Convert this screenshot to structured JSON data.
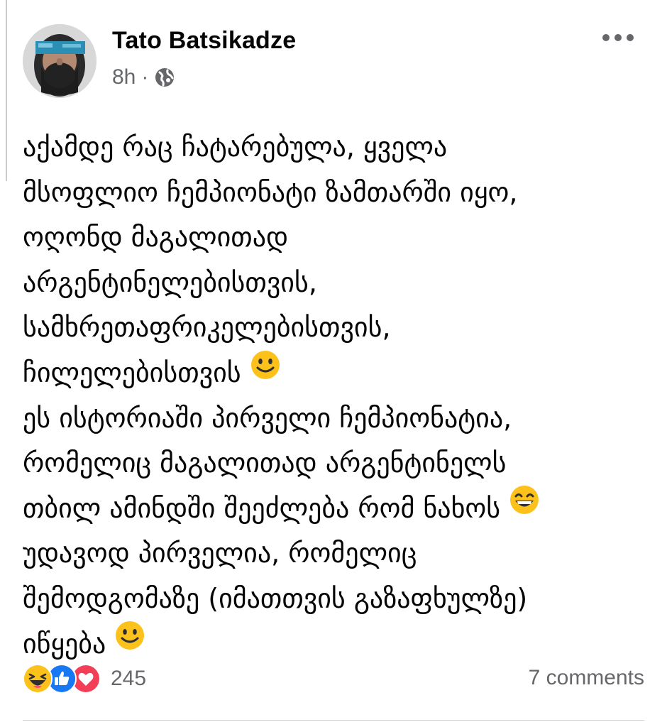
{
  "post": {
    "author": "Tato Batsikadze",
    "time": "8h",
    "separator": "·",
    "privacy_icon": "globe-icon",
    "more_icon": "more-options-icon",
    "lines": [
      "აქამდე რაც ჩატარებულა, ყველა",
      "მსოფლიო ჩემპიონატი ზამთარში იყო,",
      "ოღონდ მაგალითად",
      "არგენტინელებისთვის,",
      "სამხრეთაფრიკელებისთვის,",
      "ჩილელებისთვის",
      "ეს ისტორიაში პირველი ჩემპიონატია,",
      "რომელიც მაგალითად არგენტინელს",
      "თბილ ამინდში შეეძლება რომ ნახოს",
      "უდავოდ პირველია, რომელიც",
      "შემოდგომაზე (იმათთვის გაზაფხულზე)",
      "იწყება"
    ],
    "emojis": {
      "line_6": "slightly-smiling-face",
      "line_9": "grinning-face-with-smiling-eyes",
      "line_12": "slightly-smiling-face"
    }
  },
  "footer": {
    "reaction_icons": [
      "laughing-reaction-icon",
      "like-reaction-icon",
      "love-reaction-icon"
    ],
    "reaction_count": "245",
    "comments_label": "7 comments"
  },
  "colors": {
    "text": "#050505",
    "secondary": "#65676b",
    "like_blue": "#1877f2",
    "love_red": "#f33e58",
    "emoji_yellow": "#fcc21b"
  }
}
